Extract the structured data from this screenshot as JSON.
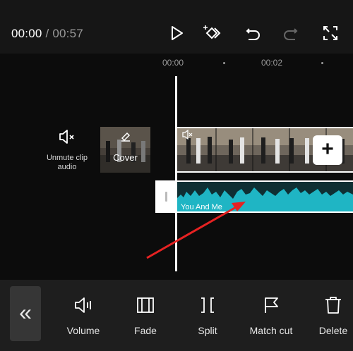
{
  "header": {
    "current_time": "00:00",
    "separator": "/",
    "duration": "00:57"
  },
  "ruler": {
    "labels": [
      "00:00",
      "00:02"
    ]
  },
  "track": {
    "unmute_label": "Unmute clip audio",
    "cover_label": "Cover",
    "audio_clip_name": "You And Me",
    "add_symbol": "+"
  },
  "toolbar": {
    "collapse_symbol": "«",
    "items": [
      {
        "label": "Volume",
        "icon": "volume-icon"
      },
      {
        "label": "Fade",
        "icon": "fade-icon"
      },
      {
        "label": "Split",
        "icon": "split-icon"
      },
      {
        "label": "Match cut",
        "icon": "flag-icon"
      },
      {
        "label": "Delete",
        "icon": "trash-icon"
      }
    ]
  },
  "colors": {
    "waveform": "#1fb5c4",
    "arrow": "#e62222",
    "background": "#0c0c0c"
  }
}
